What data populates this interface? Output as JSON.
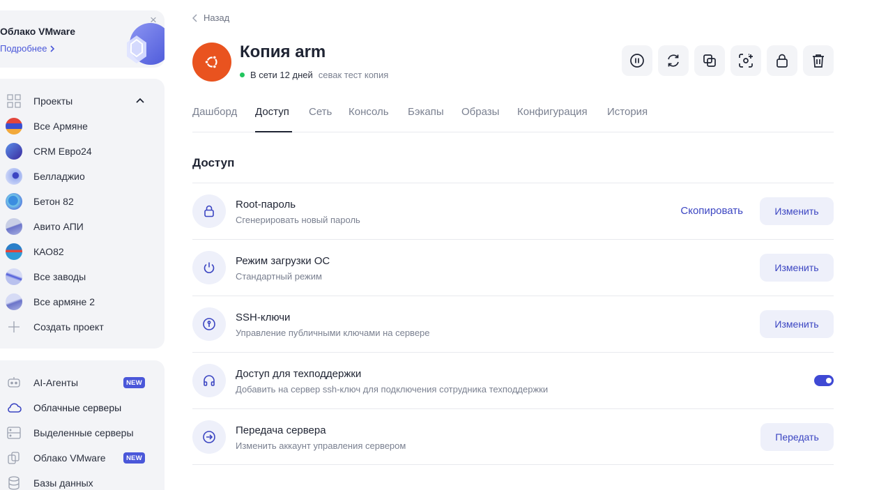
{
  "promo": {
    "title": "Облако VMware",
    "link": "Подробнее"
  },
  "sidebar": {
    "projects_label": "Проекты",
    "projects": [
      {
        "label": "Все Армяне"
      },
      {
        "label": "CRM Евро24"
      },
      {
        "label": "Белладжио"
      },
      {
        "label": "Бетон 82"
      },
      {
        "label": "Авито АПИ"
      },
      {
        "label": "КАО82"
      },
      {
        "label": "Все заводы"
      },
      {
        "label": "Все армяне 2"
      }
    ],
    "create_project": "Создать проект",
    "nav": [
      {
        "label": "AI-Агенты",
        "badge": "NEW"
      },
      {
        "label": "Облачные серверы"
      },
      {
        "label": "Выделенные серверы"
      },
      {
        "label": "Облако VMware",
        "badge": "NEW"
      },
      {
        "label": "Базы данных"
      }
    ]
  },
  "back_label": "Назад",
  "server": {
    "name": "Копия arm",
    "status": "В сети 12 дней",
    "comment": "севак тест копия"
  },
  "action_icons": [
    "pause-icon",
    "refresh-icon",
    "copy-icon",
    "snapshot-icon",
    "lock-icon",
    "trash-icon"
  ],
  "tabs": [
    "Дашборд",
    "Доступ",
    "Сеть",
    "Консоль",
    "Бэкапы",
    "Образы",
    "Конфигурация",
    "История"
  ],
  "active_tab": "Доступ",
  "section_title": "Доступ",
  "access_items": [
    {
      "title": "Root-пароль",
      "desc": "Сгенерировать новый пароль",
      "link": "Скопировать",
      "button": "Изменить"
    },
    {
      "title": "Режим загрузки ОС",
      "desc": "Стандартный режим",
      "button": "Изменить"
    },
    {
      "title": "SSH-ключи",
      "desc": "Управление публичными ключами на сервере",
      "button": "Изменить"
    },
    {
      "title": "Доступ для техподдержки",
      "desc": "Добавить на сервер ssh-ключ для подключения сотрудника техподдержки",
      "toggle": true
    },
    {
      "title": "Передача сервера",
      "desc": "Изменить аккаунт управления сервером",
      "button": "Передать"
    }
  ],
  "colors": {
    "accent": "#4a57d9",
    "ubuntu": "#e9531f",
    "online": "#22c55e"
  }
}
